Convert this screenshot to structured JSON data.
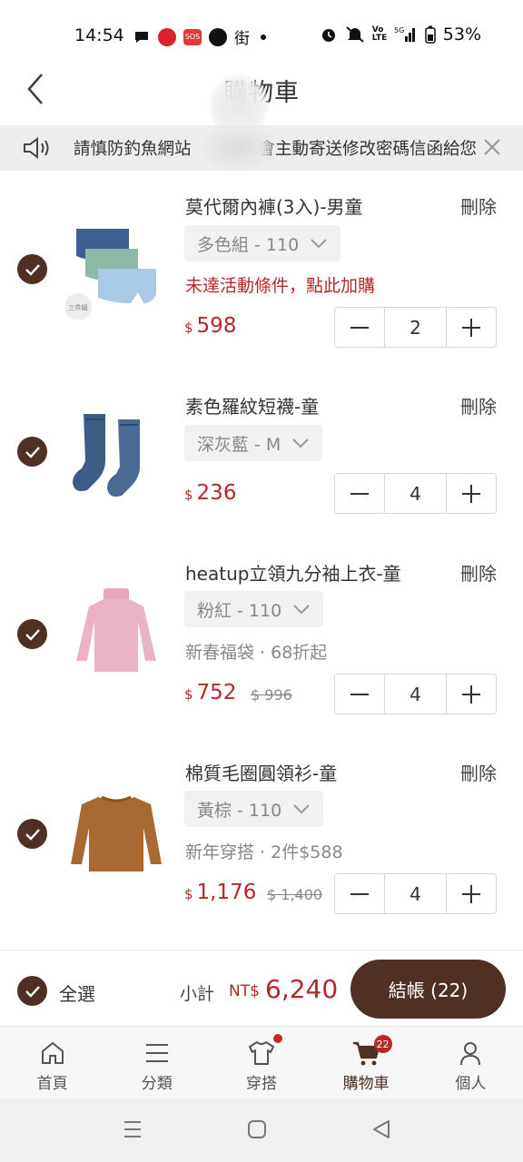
{
  "status_bar": {
    "time": "14:54",
    "battery": "53%",
    "indicators": [
      "message-icon",
      "app-icon",
      "sos-icon",
      "line-icon",
      "street-icon",
      "dot-icon",
      "alarm-icon",
      "mute-icon",
      "volte-icon",
      "5g-signal-icon",
      "battery-icon"
    ]
  },
  "header": {
    "title": "購物車",
    "back_icon": "chevron-left-icon"
  },
  "notice": {
    "text": "請慎防釣魚網站　　　　會主動寄送修改密碼信函給您",
    "icon": "speaker-icon",
    "close_icon": "close-icon"
  },
  "items": [
    {
      "name": "莫代爾內褲(3入)-男童",
      "delete": "刪除",
      "variant": "多色組 - 110",
      "promo": "未達活動條件，點此加購",
      "currency": "$",
      "price": "598",
      "original_price": "",
      "qty": "2",
      "badge": "三件組",
      "checked": true
    },
    {
      "name": "素色羅紋短襪-童",
      "delete": "刪除",
      "variant": "深灰藍 - M",
      "promo": "",
      "currency": "$",
      "price": "236",
      "original_price": "",
      "qty": "4",
      "checked": true
    },
    {
      "name": "heatup立領九分袖上衣-童",
      "delete": "刪除",
      "variant": "粉紅 - 110",
      "promo": "新春福袋 · 68折起",
      "currency": "$",
      "price": "752",
      "original_price": "$ 996",
      "qty": "4",
      "checked": true
    },
    {
      "name": "棉質毛圈圓領衫-童",
      "delete": "刪除",
      "variant": "黃棕 - 110",
      "promo": "新年穿搭 · 2件$588",
      "currency": "$",
      "price": "1,176",
      "original_price": "$ 1,400",
      "qty": "4",
      "checked": true
    }
  ],
  "summary": {
    "select_all": "全選",
    "subtotal_label": "小計",
    "currency": "NT$",
    "subtotal": "6,240",
    "checkout": "結帳 (22)"
  },
  "bottom_nav": [
    {
      "label": "首頁",
      "icon": "home-icon"
    },
    {
      "label": "分類",
      "icon": "menu-icon"
    },
    {
      "label": "穿搭",
      "icon": "shirt-icon"
    },
    {
      "label": "購物車",
      "icon": "cart-icon",
      "badge": "22",
      "active": true
    },
    {
      "label": "個人",
      "icon": "user-icon"
    }
  ],
  "colors": {
    "brand_brown": "#4e3025",
    "price_red": "#b5282a",
    "notice_bg": "#ededed"
  }
}
